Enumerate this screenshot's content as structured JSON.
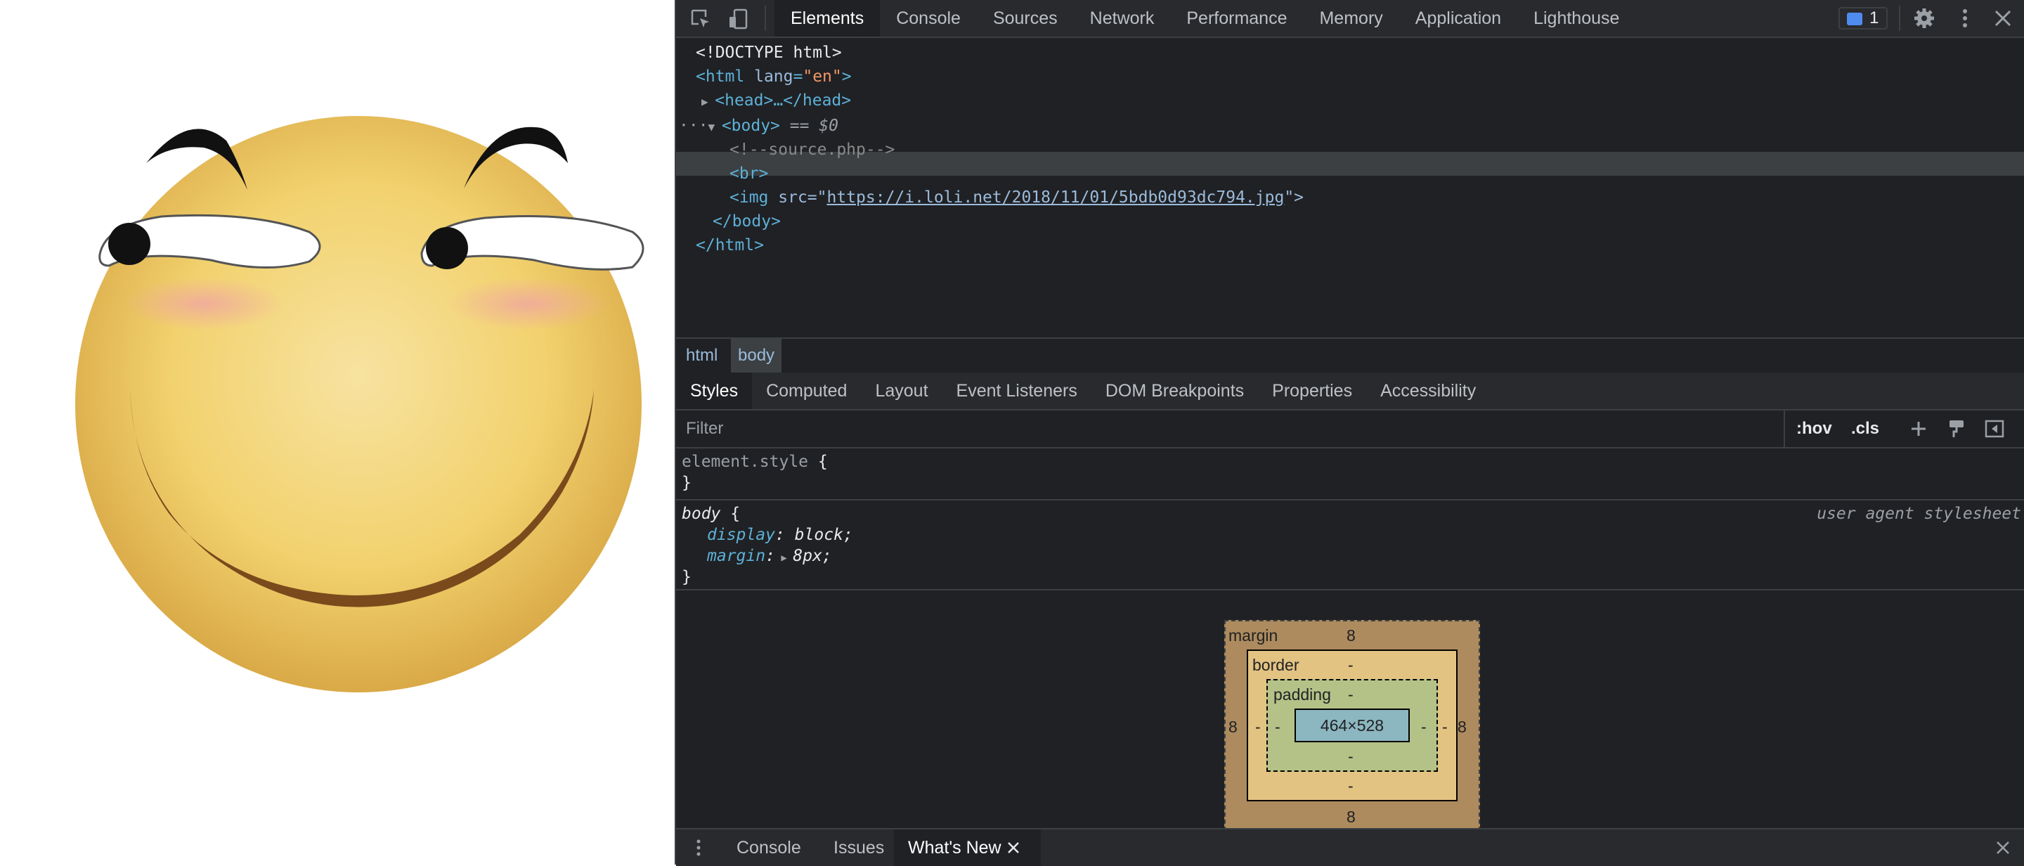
{
  "devtools": {
    "tabs": [
      "Elements",
      "Console",
      "Sources",
      "Network",
      "Performance",
      "Memory",
      "Application",
      "Lighthouse"
    ],
    "active_tab": "Elements",
    "issues_count": "1"
  },
  "dom": {
    "doctype": "<!DOCTYPE html>",
    "html_open_tag": "<html",
    "html_lang_attr": "lang",
    "html_lang_value": "\"en\"",
    "head_collapsed": "<head>…</head>",
    "body_open": "<body>",
    "body_selected_suffix": "== $0",
    "comment": "<!--source.php-->",
    "br": "<br>",
    "img_tag": "<img",
    "img_src_attr": "src=\"",
    "img_src": "https://i.loli.net/2018/11/01/5bdb0d93dc794.jpg",
    "img_close": "\">",
    "body_close": "</body>",
    "html_close": "</html>",
    "html_open_close": ">",
    "ellipsis": "···"
  },
  "breadcrumbs": [
    "html",
    "body"
  ],
  "styles_tabs": [
    "Styles",
    "Computed",
    "Layout",
    "Event Listeners",
    "DOM Breakpoints",
    "Properties",
    "Accessibility"
  ],
  "filter": {
    "placeholder": "Filter",
    "hov": ":hov",
    "cls": ".cls"
  },
  "rules": {
    "element_style_selector": "element.style",
    "open_brace": "{",
    "close_brace": "}",
    "body_selector": "body",
    "source": "user agent stylesheet",
    "prop1_name": "display",
    "prop1_value": "block;",
    "prop2_name": "margin",
    "prop2_value": "8px;",
    "colon": ":"
  },
  "box_model": {
    "margin_label": "margin",
    "border_label": "border",
    "padding_label": "padding",
    "margin_top": "8",
    "margin_bottom": "8",
    "margin_left": "8",
    "margin_right": "8",
    "border_top": "-",
    "border_bottom": "-",
    "border_left": "-",
    "border_right": "-",
    "padding_top": "-",
    "padding_bottom": "-",
    "padding_left": "-",
    "padding_right": "-",
    "content_size": "464×528"
  },
  "drawer": {
    "tabs": [
      "Console",
      "Issues",
      "What's New"
    ],
    "active_tab": "What's New"
  },
  "colors": {
    "devtools_bg": "#202124",
    "toolbar_bg": "#292a2d",
    "tag_blue": "#5db0d7",
    "attr_value_orange": "#f29766",
    "link_blue": "#9bbbdc",
    "smiley_yellow": "#f5d97a",
    "margin_brown": "#ad8b5e",
    "border_tan": "#e3c382",
    "padding_green": "#b5c287",
    "content_blue": "#8cb6c0"
  }
}
